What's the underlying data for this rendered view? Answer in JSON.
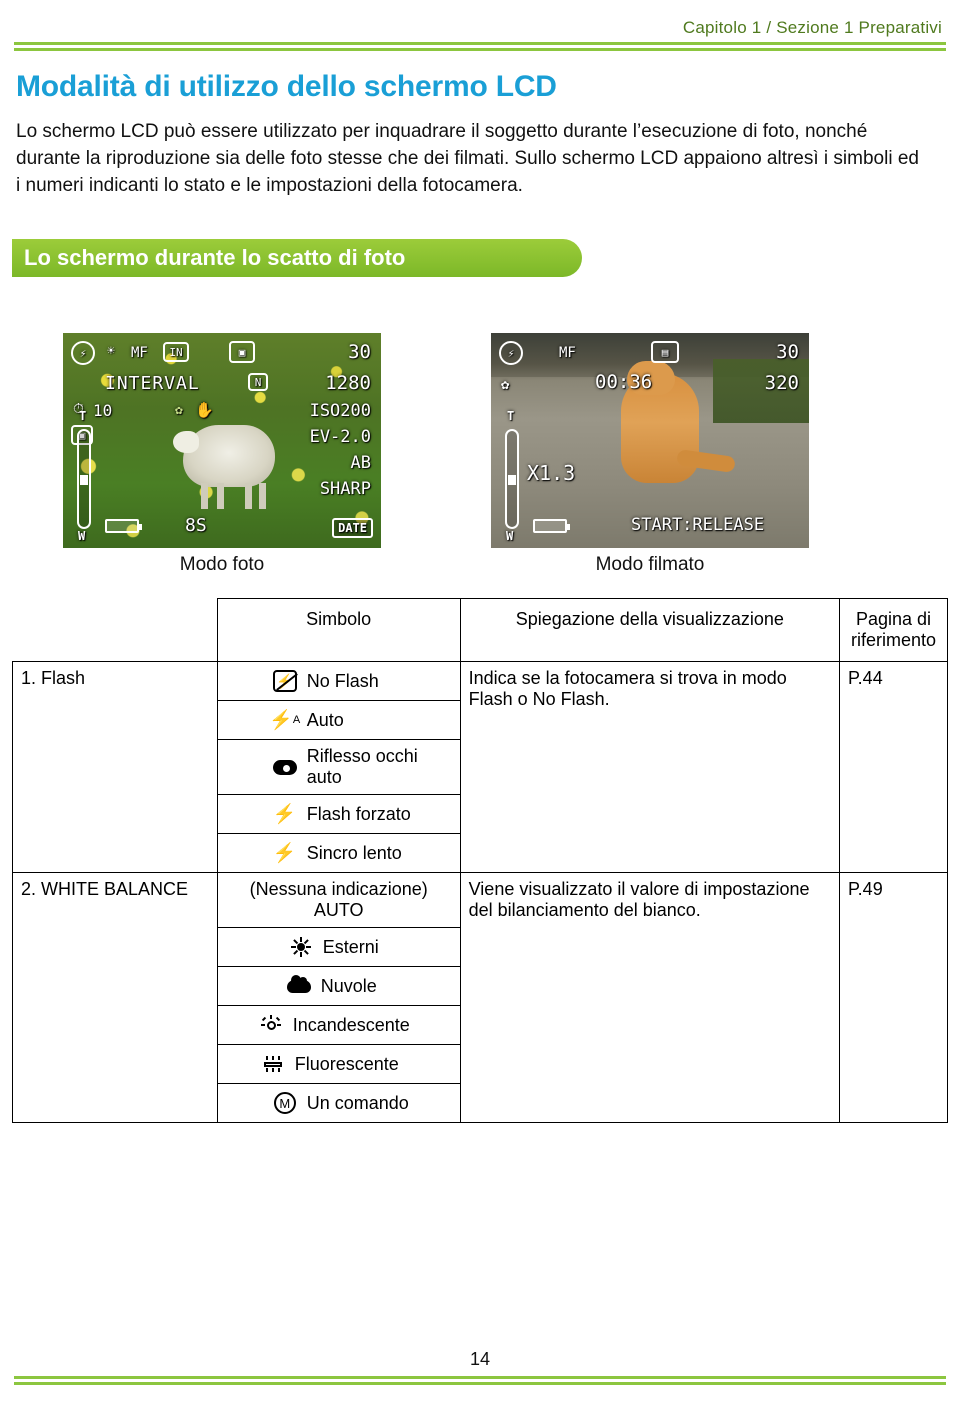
{
  "header": {
    "breadcrumb": "Capitolo 1 / Sezione 1  Preparativi",
    "accent_color": "#8cc63f",
    "breadcrumb_color": "#4f7a1e"
  },
  "title": {
    "text": "Modalità di utilizzo dello schermo LCD",
    "color": "#1a9fd6"
  },
  "intro": {
    "text": "Lo schermo LCD può essere utilizzato per inquadrare il soggetto durante l’esecuzione di foto, nonché durante la riproduzione sia delle foto stesse che dei filmati. Sullo schermo LCD appaiono altresì i simboli ed i numeri indicanti lo stato e le impostazioni della fotocamera."
  },
  "banner": {
    "text": "Lo schermo durante lo scatto di foto"
  },
  "lcd_photo": {
    "caption": "Modo foto",
    "osd": {
      "flash": "⚡",
      "wb": "☀",
      "focus": "MF",
      "memory": "IN",
      "mode_icon": "▣",
      "frames": "30",
      "interval": "INTERVAL",
      "size_icon": "N",
      "size": "1280",
      "self_timer": "10",
      "macro_icon": "✿",
      "shake_icon": "✋",
      "iso": "ISO200",
      "ev": "EV-2.0",
      "ab": "AB",
      "sharp": "SHARP",
      "shutter": "8S",
      "date": "DATE",
      "zoom_t": "T",
      "zoom_w": "W"
    }
  },
  "lcd_movie": {
    "caption": "Modo filmato",
    "osd": {
      "flash": "⚡",
      "focus": "MF",
      "movie_icon": "▤",
      "frames": "30",
      "size": "320",
      "time": "00:36",
      "macro_icon": "✿",
      "digital_zoom": "X1.3",
      "start_release": "START:RELEASE",
      "zoom_t": "T",
      "zoom_w": "W"
    }
  },
  "table": {
    "headers": {
      "item": "",
      "symbol": "Simbolo",
      "description": "Spiegazione della visualizzazione",
      "page": "Pagina di riferimento"
    },
    "rows": [
      {
        "item": "1. Flash",
        "symbols": [
          {
            "glyph": "no-flash-icon",
            "label": "No Flash"
          },
          {
            "glyph": "flash-auto-icon",
            "label": "Auto"
          },
          {
            "glyph": "red-eye-icon",
            "label": "Riflesso occhi auto"
          },
          {
            "glyph": "flash-forced-icon",
            "label": "Flash forzato"
          },
          {
            "glyph": "slow-sync-icon",
            "label": "Sincro lento"
          }
        ],
        "description": "Indica se la fotocamera si trova in modo Flash o No Flash.",
        "page": "P.44"
      },
      {
        "item": "2. WHITE BALANCE",
        "symbols": [
          {
            "glyph": "none-icon",
            "label": "(Nessuna indicazione)\nAUTO"
          },
          {
            "glyph": "sun-icon",
            "label": "Esterni"
          },
          {
            "glyph": "cloud-icon",
            "label": "Nuvole"
          },
          {
            "glyph": "incandescent-icon",
            "label": "Incandescente"
          },
          {
            "glyph": "fluorescent-icon",
            "label": "Fluorescente"
          },
          {
            "glyph": "manual-icon",
            "label": "Un comando"
          }
        ],
        "description": "Viene visualizzato il valore di impostazione del bilanciamento del bianco.",
        "page": "P.49"
      }
    ]
  },
  "footer": {
    "page_number": "14"
  }
}
